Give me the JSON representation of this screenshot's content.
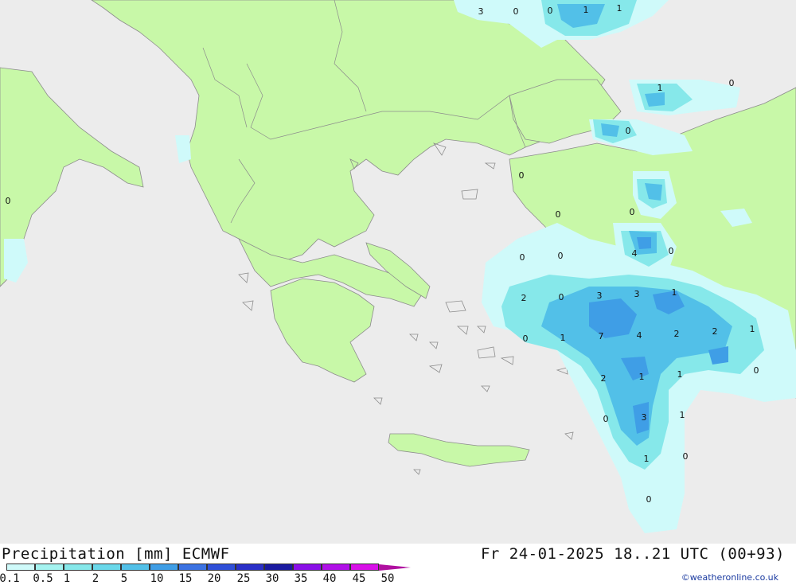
{
  "header": {
    "title": "Precipitation [mm] ECMWF",
    "valid_time": "Fr 24-01-2025 18..21 UTC (00+93)"
  },
  "legend": {
    "ticks": [
      "0.1",
      "0.5",
      "1",
      "2",
      "5",
      "10",
      "15",
      "20",
      "25",
      "30",
      "35",
      "40",
      "45",
      "50"
    ],
    "colors": [
      "#cffafa",
      "#a5f3f0",
      "#86e8ea",
      "#6ad8ea",
      "#52c0e8",
      "#3f9ee6",
      "#3b72e2",
      "#2f4fd8",
      "#2a30c8",
      "#1a1aa0",
      "#8a10e8",
      "#b010e8",
      "#d810e8",
      "#e020d0",
      "#b010a0"
    ]
  },
  "credit": "©weatheronline.co.uk",
  "map_values": [
    "3",
    "0",
    "0",
    "1",
    "1",
    "1",
    "0",
    "0",
    "0",
    "0",
    "0",
    "0",
    "0",
    "4",
    "0",
    "2",
    "0",
    "3",
    "3",
    "1",
    "0",
    "1",
    "7",
    "4",
    "2",
    "2",
    "1",
    "0",
    "2",
    "1",
    "1",
    "0",
    "3",
    "1",
    "1",
    "0",
    "0",
    "0"
  ],
  "colors": {
    "sea": "#ececec",
    "land": "#c8f8a8",
    "border": "#8c8c8c"
  }
}
